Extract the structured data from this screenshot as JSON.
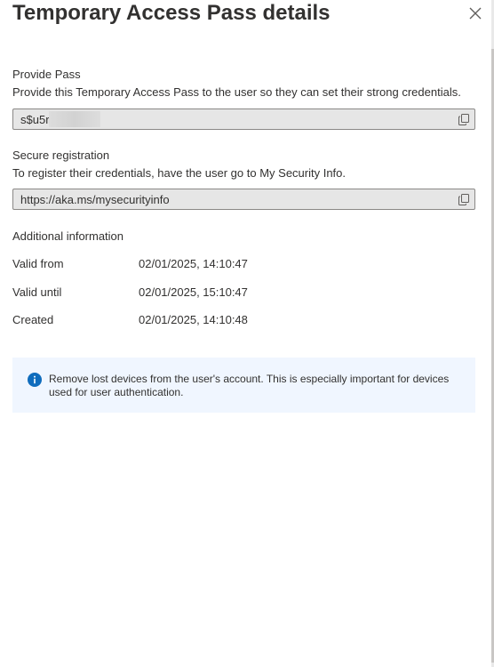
{
  "panel": {
    "title": "Temporary Access Pass details",
    "close_label": "×"
  },
  "provide_pass": {
    "label": "Provide Pass",
    "description": "Provide this Temporary Access Pass to the user so they can set their strong credentials.",
    "value": "s$u5r"
  },
  "secure_registration": {
    "label": "Secure registration",
    "description": "To register their credentials, have the user go to My Security Info.",
    "value": "https://aka.ms/mysecurityinfo"
  },
  "additional_info": {
    "heading": "Additional information",
    "rows": [
      {
        "label": "Valid from",
        "value": "02/01/2025, 14:10:47"
      },
      {
        "label": "Valid until",
        "value": "02/01/2025, 15:10:47"
      },
      {
        "label": "Created",
        "value": "02/01/2025, 14:10:48"
      }
    ]
  },
  "banner": {
    "text": "Remove lost devices from the user's account. This is especially important for devices used for user authentication."
  },
  "colors": {
    "accent": "#0f6cbd",
    "banner_bg": "#f0f6ff",
    "field_bg": "#e6e6e6"
  },
  "icons": {
    "close": "close-icon",
    "copy": "copy-icon",
    "info": "info-icon"
  }
}
